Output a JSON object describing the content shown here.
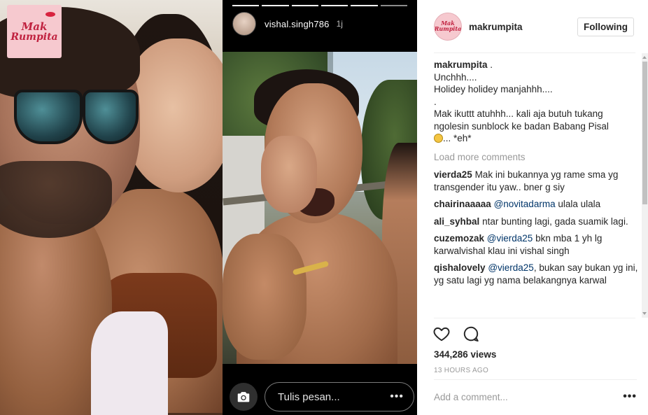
{
  "logo": {
    "line1": "Mak",
    "line2": "Rumpita"
  },
  "story": {
    "username": "vishal.singh786",
    "time": "1j",
    "message_placeholder": "Tulis pesan...",
    "more": "•••"
  },
  "post": {
    "username": "makrumpita",
    "follow_label": "Following",
    "avatar_line1": "Mak",
    "avatar_line2": "Rumpita"
  },
  "caption": {
    "user": "makrumpita",
    "suffix": ".",
    "lines": [
      "Unchhh....",
      "Holidey holidey manjahhh....",
      ".",
      "Mak ikuttt atuhhh... kali aja butuh tukang",
      "ngolesin sunblock ke badan Babang Pisal"
    ],
    "last_line": "... *eh*"
  },
  "load_more": "Load more comments",
  "comments": [
    {
      "user": "vierda25",
      "mention": "",
      "text": "Mak ini bukannya yg rame sma yg transgender itu yaw.. bner g siy"
    },
    {
      "user": "chairinaaaaa",
      "mention": "@novitadarma",
      "text": "ulala ulala"
    },
    {
      "user": "ali_syhbal",
      "mention": "",
      "text": "ntar bunting lagi, gada suamik lagi."
    },
    {
      "user": "cuzemozak",
      "mention": "@vierda25",
      "text": "bkn mba 1 yh lg karwalvishal klau ini vishal singh"
    },
    {
      "user": "qishalovely",
      "mention": "@vierda25",
      "text": ", bukan say bukan yg ini, yg satu lagi yg nama belakangnya karwal"
    }
  ],
  "stats": {
    "views": "344,286 views",
    "time": "13 HOURS AGO"
  },
  "add_comment": {
    "placeholder": "Add a comment...",
    "more": "•••"
  },
  "icons": [
    "heart-icon",
    "comment-icon",
    "camera-icon",
    "more-icon"
  ],
  "colors": {
    "mention": "#003569",
    "muted": "#999999",
    "text": "#262626"
  }
}
